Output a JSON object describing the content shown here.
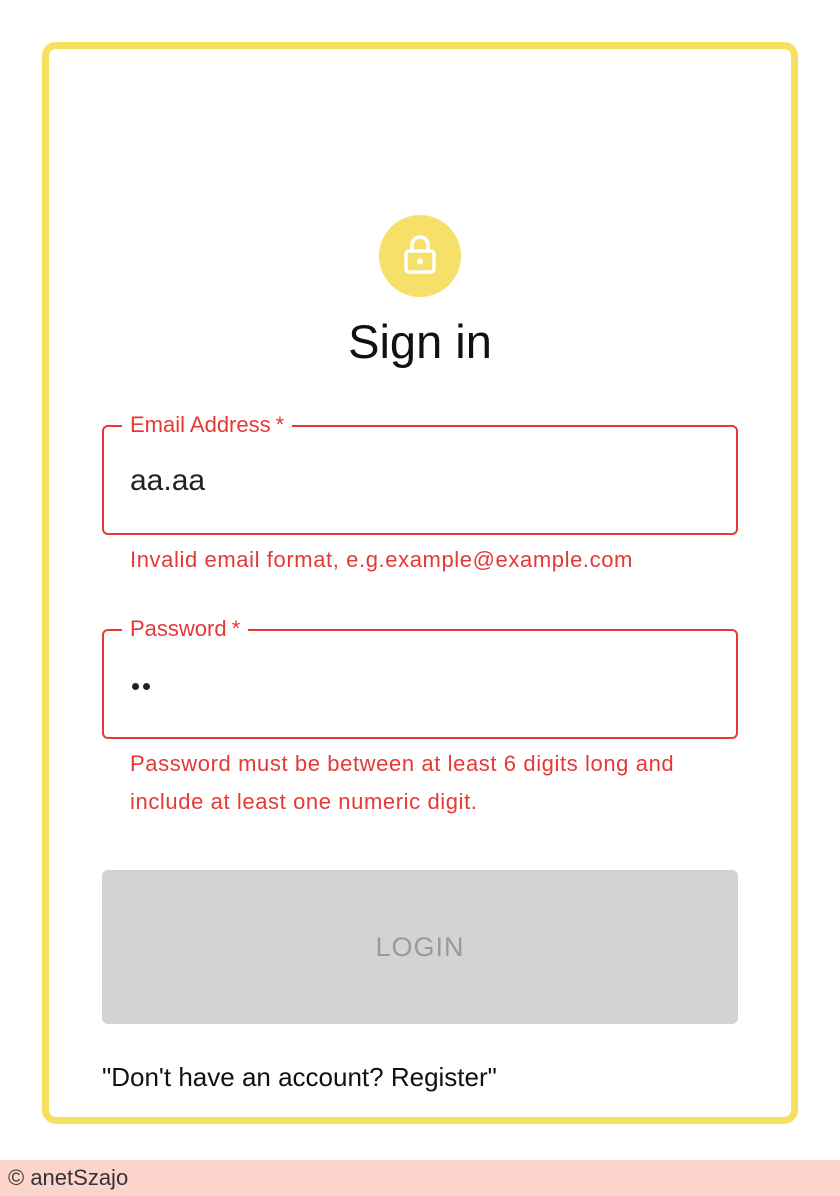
{
  "form": {
    "title": "Sign in",
    "lock_icon": "lock-icon",
    "accent_color": "#f6e05e",
    "error_color": "#e53935"
  },
  "email": {
    "label": "Email Address",
    "required_mark": "*",
    "value": "aa.aa",
    "error": "Invalid email format, e.g.example@example.com"
  },
  "password": {
    "label": "Password",
    "required_mark": "*",
    "masked_length": 2,
    "error": "Password must be between at least 6 digits long and include at least one numeric digit."
  },
  "login": {
    "label": "LOGIN",
    "disabled": true
  },
  "register": {
    "text": "\"Don't have an account? Register\""
  },
  "footer": {
    "credit": "© anetSzajo"
  }
}
